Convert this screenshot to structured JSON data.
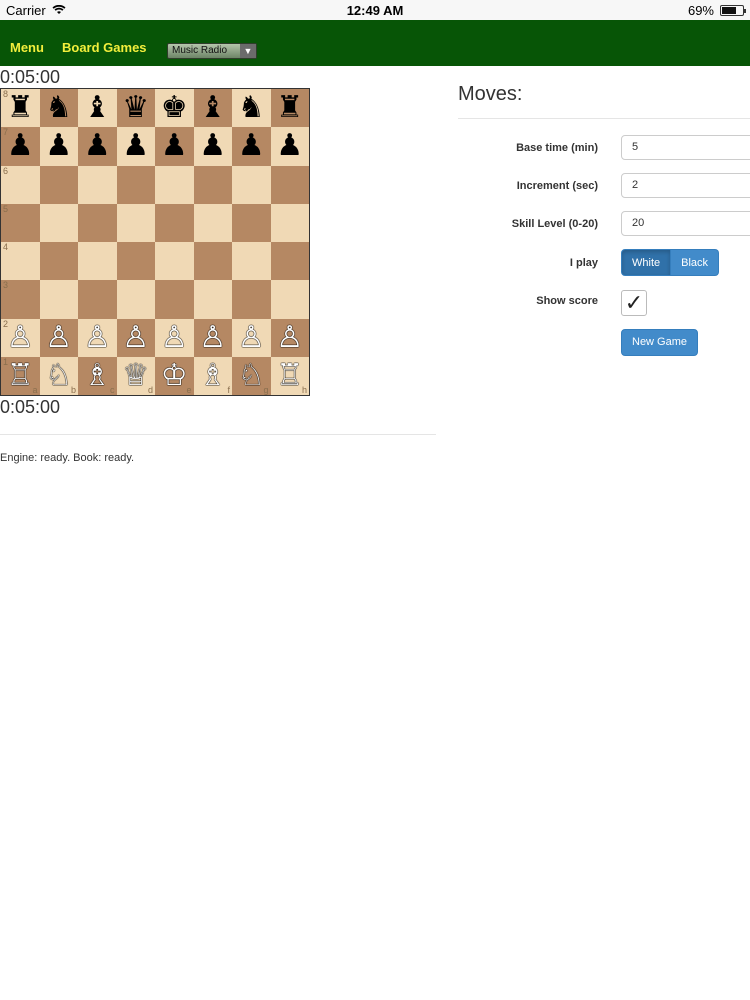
{
  "status_bar": {
    "carrier": "Carrier",
    "time": "12:49 AM",
    "battery": "69%",
    "battery_level": 0.69
  },
  "nav": {
    "menu": "Menu",
    "board_games": "Board Games",
    "radio_select": "Music Radio"
  },
  "timers": {
    "top": "0:05:00",
    "bottom": "0:05:00"
  },
  "board": {
    "ranks": [
      "8",
      "7",
      "6",
      "5",
      "4",
      "3",
      "2",
      "1"
    ],
    "files": [
      "a",
      "b",
      "c",
      "d",
      "e",
      "f",
      "g",
      "h"
    ],
    "rows": [
      [
        "♜",
        "♞",
        "♝",
        "♛",
        "♚",
        "♝",
        "♞",
        "♜"
      ],
      [
        "♟",
        "♟",
        "♟",
        "♟",
        "♟",
        "♟",
        "♟",
        "♟"
      ],
      [
        "",
        "",
        "",
        "",
        "",
        "",
        "",
        ""
      ],
      [
        "",
        "",
        "",
        "",
        "",
        "",
        "",
        ""
      ],
      [
        "",
        "",
        "",
        "",
        "",
        "",
        "",
        ""
      ],
      [
        "",
        "",
        "",
        "",
        "",
        "",
        "",
        ""
      ],
      [
        "♙",
        "♙",
        "♙",
        "♙",
        "♙",
        "♙",
        "♙",
        "♙"
      ],
      [
        "♖",
        "♘",
        "♗",
        "♕",
        "♔",
        "♗",
        "♘",
        "♖"
      ]
    ]
  },
  "engine_status": "Engine: ready. Book: ready.",
  "moves_title": "Moves:",
  "form": {
    "base_time_label": "Base time (min)",
    "base_time_value": "5",
    "increment_label": "Increment (sec)",
    "increment_value": "2",
    "skill_label": "Skill Level (0-20)",
    "skill_value": "20",
    "i_play_label": "I play",
    "white": "White",
    "black": "Black",
    "show_score_label": "Show score",
    "show_score_checked": "✓",
    "new_game": "New Game"
  }
}
